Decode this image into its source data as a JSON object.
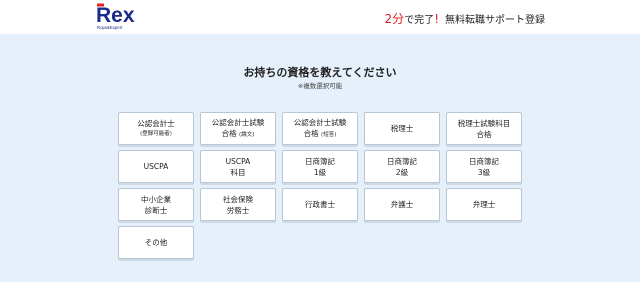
{
  "header": {
    "logo_text": "Rex",
    "logo_subtext": "Rops&Expert",
    "cta_accent": "2分",
    "cta_text1": "で完了",
    "cta_exclaim": "!",
    "cta_text2": "無料転職サポート登録"
  },
  "question": {
    "title": "お持ちの資格を教えてください",
    "note": "※複数選択可能"
  },
  "options": [
    {
      "line1": "公認会計士",
      "sub": "(登録可能者)"
    },
    {
      "line1": "公認会計士試験",
      "line2": "合格",
      "sub": "(論文)"
    },
    {
      "line1": "公認会計士試験",
      "line2": "合格",
      "sub": "(短答)"
    },
    {
      "line1": "税理士"
    },
    {
      "line1": "税理士試験科目",
      "line2": "合格"
    },
    {
      "line1": "USCPA"
    },
    {
      "line1": "USCPA",
      "line2": "科目"
    },
    {
      "line1": "日商簿記",
      "line2": "1級"
    },
    {
      "line1": "日商簿記",
      "line2": "2級"
    },
    {
      "line1": "日商簿記",
      "line2": "3級"
    },
    {
      "line1": "中小企業",
      "line2": "診断士"
    },
    {
      "line1": "社会保険",
      "line2": "労務士"
    },
    {
      "line1": "行政書士"
    },
    {
      "line1": "弁護士"
    },
    {
      "line1": "弁理士"
    },
    {
      "line1": "その他"
    }
  ]
}
